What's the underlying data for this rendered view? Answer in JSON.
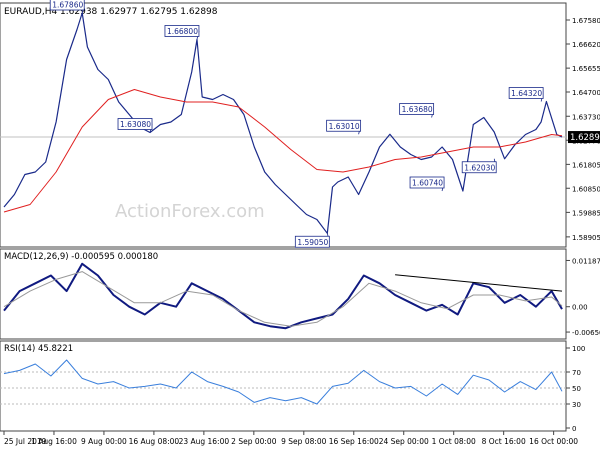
{
  "chart_data": [
    {
      "type": "line",
      "panel": "price",
      "header": "EURAUD,H4  1.62938 1.62977 1.62795 1.62898",
      "watermark": "ActionForex.com",
      "x_labels": [
        "25 Jul 2019",
        "1 Aug 16:00",
        "9 Aug 00:00",
        "16 Aug 08:00",
        "23 Aug 16:00",
        "2 Sep 00:00",
        "9 Sep 08:00",
        "16 Sep 16:00",
        "24 Sep 00:00",
        "1 Oct 08:00",
        "8 Oct 16:00",
        "16 Oct 00:00"
      ],
      "y_ticks": [
        "1.67580",
        "1.66620",
        "1.65655",
        "1.64700",
        "1.63730",
        "1.62770",
        "1.61805",
        "1.60850",
        "1.59885",
        "1.58905"
      ],
      "ylim": [
        1.5878,
        1.679
      ],
      "current_price": 1.62898,
      "current_price_label": "1.62898",
      "annotations": [
        {
          "label": "1.67860",
          "x": 15,
          "y": 1.6786
        },
        {
          "label": "1.66800",
          "x": 37,
          "y": 1.668
        },
        {
          "label": "1.63080",
          "x": 28,
          "y": 1.6308
        },
        {
          "label": "1.59050",
          "x": 62,
          "y": 1.5905
        },
        {
          "label": "1.63010",
          "x": 68,
          "y": 1.6301
        },
        {
          "label": "1.63680",
          "x": 82,
          "y": 1.6368
        },
        {
          "label": "1.60740",
          "x": 84,
          "y": 1.6074
        },
        {
          "label": "1.62030",
          "x": 94,
          "y": 1.6203
        },
        {
          "label": "1.64320",
          "x": 103,
          "y": 1.6432
        }
      ],
      "series": [
        {
          "name": "price",
          "color": "#1a2a8a",
          "x": [
            0,
            2,
            4,
            6,
            8,
            10,
            12,
            14,
            15,
            16,
            18,
            20,
            22,
            24,
            26,
            28,
            30,
            32,
            34,
            36,
            37,
            38,
            40,
            42,
            44,
            46,
            48,
            50,
            52,
            54,
            56,
            58,
            60,
            62,
            63,
            64,
            66,
            68,
            70,
            72,
            74,
            76,
            78,
            80,
            82,
            84,
            86,
            88,
            90,
            92,
            94,
            96,
            98,
            100,
            102,
            103,
            104,
            106,
            107
          ],
          "values": [
            1.601,
            1.606,
            1.614,
            1.615,
            1.619,
            1.635,
            1.66,
            1.672,
            1.6786,
            1.665,
            1.656,
            1.652,
            1.643,
            1.638,
            1.633,
            1.6308,
            1.634,
            1.635,
            1.638,
            1.655,
            1.668,
            1.645,
            1.644,
            1.646,
            1.644,
            1.638,
            1.625,
            1.615,
            1.61,
            1.606,
            1.602,
            1.598,
            1.596,
            1.5905,
            1.609,
            1.611,
            1.613,
            1.606,
            1.615,
            1.625,
            1.6301,
            1.625,
            1.622,
            1.62,
            1.621,
            1.625,
            1.62,
            1.6074,
            1.634,
            1.6368,
            1.631,
            1.6203,
            1.626,
            1.63,
            1.632,
            1.635,
            1.6432,
            1.63,
            1.629
          ]
        },
        {
          "name": "SMA",
          "color": "#e02020",
          "x": [
            0,
            5,
            10,
            15,
            20,
            25,
            30,
            35,
            40,
            45,
            50,
            55,
            60,
            65,
            70,
            75,
            80,
            85,
            90,
            95,
            100,
            105,
            107
          ],
          "values": [
            1.599,
            1.602,
            1.615,
            1.633,
            1.644,
            1.648,
            1.645,
            1.643,
            1.643,
            1.641,
            1.633,
            1.624,
            1.616,
            1.615,
            1.617,
            1.62,
            1.621,
            1.623,
            1.625,
            1.625,
            1.627,
            1.63,
            1.6295
          ]
        }
      ]
    },
    {
      "type": "line",
      "panel": "macd",
      "header": "MACD(12,26,9) -0.000595 0.000180",
      "y_ticks": [
        "0.01187",
        "0.00",
        "-0.006502"
      ],
      "ylim": [
        -0.007,
        0.0125
      ],
      "series": [
        {
          "name": "MACD",
          "color": "#101a80",
          "x": [
            0,
            3,
            6,
            9,
            12,
            15,
            18,
            21,
            24,
            27,
            30,
            33,
            36,
            39,
            42,
            45,
            48,
            51,
            54,
            57,
            60,
            63,
            66,
            69,
            72,
            75,
            78,
            81,
            84,
            87,
            90,
            93,
            96,
            99,
            102,
            105,
            107
          ],
          "values": [
            -0.001,
            0.004,
            0.006,
            0.008,
            0.004,
            0.011,
            0.008,
            0.003,
            0.0,
            -0.002,
            0.001,
            0.0,
            0.006,
            0.004,
            0.002,
            -0.001,
            -0.004,
            -0.005,
            -0.0055,
            -0.004,
            -0.003,
            -0.002,
            0.002,
            0.008,
            0.006,
            0.003,
            0.001,
            -0.001,
            0.0005,
            -0.002,
            0.006,
            0.005,
            0.001,
            0.003,
            0.0,
            0.004,
            -0.0006
          ]
        },
        {
          "name": "Signal",
          "color": "#999999",
          "x": [
            0,
            5,
            10,
            15,
            20,
            25,
            30,
            35,
            40,
            45,
            50,
            55,
            60,
            65,
            70,
            75,
            80,
            85,
            90,
            95,
            100,
            105,
            107
          ],
          "values": [
            0.0,
            0.004,
            0.007,
            0.009,
            0.005,
            0.001,
            0.001,
            0.004,
            0.003,
            -0.001,
            -0.004,
            -0.005,
            -0.004,
            0.0,
            0.006,
            0.004,
            0.001,
            -0.0005,
            0.003,
            0.003,
            0.0015,
            0.0025,
            0.0002
          ]
        },
        {
          "name": "Trendline",
          "color": "#000000",
          "x": [
            75,
            107
          ],
          "values": [
            0.0082,
            0.004
          ]
        }
      ]
    },
    {
      "type": "line",
      "panel": "rsi",
      "header": "RSI(14) 45.8221",
      "y_ticks": [
        "100",
        "70",
        "50",
        "30",
        "0"
      ],
      "ylim": [
        0,
        100
      ],
      "levels": [
        70,
        50,
        30
      ],
      "series": [
        {
          "name": "RSI",
          "color": "#3a7fdc",
          "x": [
            0,
            3,
            6,
            9,
            12,
            15,
            18,
            21,
            24,
            27,
            30,
            33,
            36,
            39,
            42,
            45,
            48,
            51,
            54,
            57,
            60,
            63,
            66,
            69,
            72,
            75,
            78,
            81,
            84,
            87,
            90,
            93,
            96,
            99,
            102,
            105,
            107
          ],
          "values": [
            68,
            72,
            80,
            65,
            85,
            62,
            55,
            58,
            50,
            52,
            55,
            50,
            70,
            58,
            52,
            45,
            32,
            38,
            34,
            38,
            30,
            52,
            56,
            72,
            58,
            50,
            52,
            40,
            55,
            42,
            66,
            60,
            45,
            58,
            48,
            70,
            45.8221
          ]
        }
      ]
    }
  ]
}
